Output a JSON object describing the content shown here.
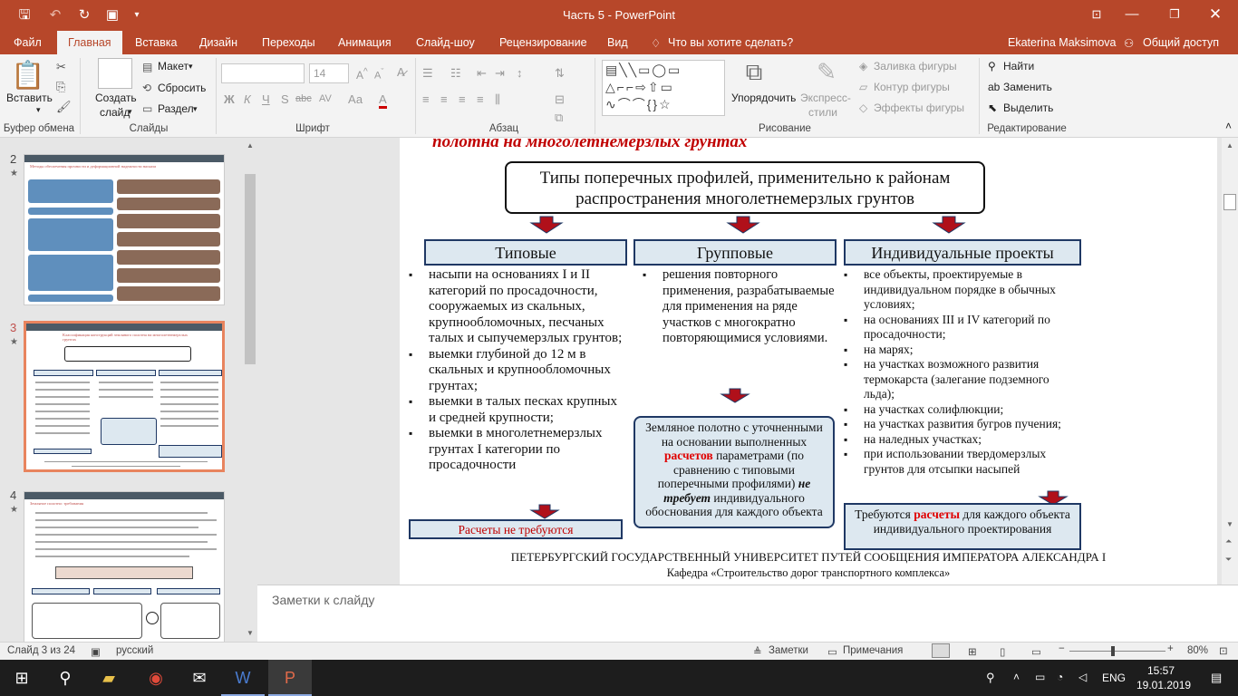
{
  "window": {
    "title": "Часть 5 - PowerPoint"
  },
  "quick_access": [
    "save-icon",
    "undo-icon",
    "redo-icon",
    "start-from-beginning-icon",
    "customize-icon"
  ],
  "window_controls": [
    "ribbon-display-icon",
    "minimize-icon",
    "maximize-icon",
    "close-icon"
  ],
  "tabs": [
    "Файл",
    "Главная",
    "Вставка",
    "Дизайн",
    "Переходы",
    "Анимация",
    "Слайд-шоу",
    "Рецензирование",
    "Вид"
  ],
  "tell_me": "Что вы хотите сделать?",
  "user": "Ekaterina Maksimova",
  "share": "Общий доступ",
  "ribbon": {
    "clipboard": {
      "paste": "Вставить",
      "group": "Буфер обмена"
    },
    "slides": {
      "new_slide": "Создать",
      "new_slide2": "слайд",
      "layout": "Макет",
      "reset": "Сбросить",
      "section": "Раздел",
      "group": "Слайды"
    },
    "font": {
      "font_name": "",
      "font_size": "14",
      "group": "Шрифт",
      "buttons": [
        "Ж",
        "К",
        "Ч",
        "S",
        "abc",
        "AV",
        "Аа",
        "А"
      ]
    },
    "paragraph": {
      "group": "Абзац"
    },
    "drawing": {
      "arrange": "Упорядочить",
      "quick_styles": "Экспресс-",
      "quick_styles2": "стили",
      "fill": "Заливка фигуры",
      "outline": "Контур фигуры",
      "effects": "Эффекты фигуры",
      "group": "Рисование"
    },
    "editing": {
      "find": "Найти",
      "replace": "Заменить",
      "select": "Выделить",
      "group": "Редактирование"
    }
  },
  "thumbnails": [
    {
      "number": "2",
      "star": "★",
      "title": "Методы обеспечения прочности и деформационной надежности насыпи"
    },
    {
      "number": "3",
      "star": "★",
      "title": "Классификация конструкций земляного полотна на многолетнемерзлых грунтах"
    },
    {
      "number": "4",
      "star": "★",
      "title": "Земляное полотно: требования"
    }
  ],
  "slide": {
    "title_partial": "полотна на многолетнемерзлых грунтах",
    "main_box": "Типы поперечных профилей, применительно к районам распространения многолетнемерзлых грунтов",
    "col1_header": "Типовые",
    "col2_header": "Групповые",
    "col3_header": "Индивидуальные проекты",
    "col1_items": [
      "насыпи на основаниях I и II категорий по просадочности, сооружаемых из скальных, крупнообломочных, песчаных талых и сыпучемерзлых грунтов;",
      "выемки глубиной до 12 м в скальных и крупнообломочных грунтах;",
      "выемки в талых песках крупных и средней крупности;",
      "выемки в многолетнемерзлых грунтах I категории по просадочности"
    ],
    "col2_items": [
      "решения повторного применения, разрабатываемые для применения на ряде участков с многократно повторяющимися условиями."
    ],
    "col3_items": [
      "все объекты, проектируемые в индивидуальном порядке в обычных условиях;",
      "на основаниях III и IV категорий по просадочности;",
      "на марях;",
      "на участках возможного развития термокарста (залегание подземного льда);",
      "на участках солифлюкции;",
      "на участках развития бугров пучения;",
      "на наледных участках;",
      "при использовании твердомерзлых грунтов для отсыпки насыпей"
    ],
    "note1": "Расчеты не требуются",
    "note2_a": "Земляное полотно с уточненными на основании выполненных",
    "note2_red": "расчетов",
    "note2_b": "параметрами (по сравнению с типовыми поперечными профилями)",
    "note2_bold": "не требует",
    "note2_c": "индивидуального обоснования для каждого объекта",
    "note3_a": "Требуются",
    "note3_red": "расчеты",
    "note3_b": "для каждого объекта индивидуального проектирования",
    "footer1": "ПЕТЕРБУРГСКИЙ ГОСУДАРСТВЕННЫЙ УНИВЕРСИТЕТ ПУТЕЙ СООБЩЕНИЯ ИМПЕРАТОРА АЛЕКСАНДРА I",
    "footer2": "Кафедра «Строительство дорог транспортного комплекса»"
  },
  "notes_placeholder": "Заметки к слайду",
  "status": {
    "slide_count": "Слайд 3 из 24",
    "language": "русский",
    "notes": "Заметки",
    "comments": "Примечания",
    "zoom": "80%"
  },
  "taskbar": {
    "language": "ENG",
    "time": "15:57",
    "date": "19.01.2019"
  },
  "colors": {
    "accent": "#b7472a",
    "header_fill": "#dde8f0",
    "header_border": "#1f3864",
    "arrow": "#b0101a",
    "title_red": "#c00000"
  }
}
